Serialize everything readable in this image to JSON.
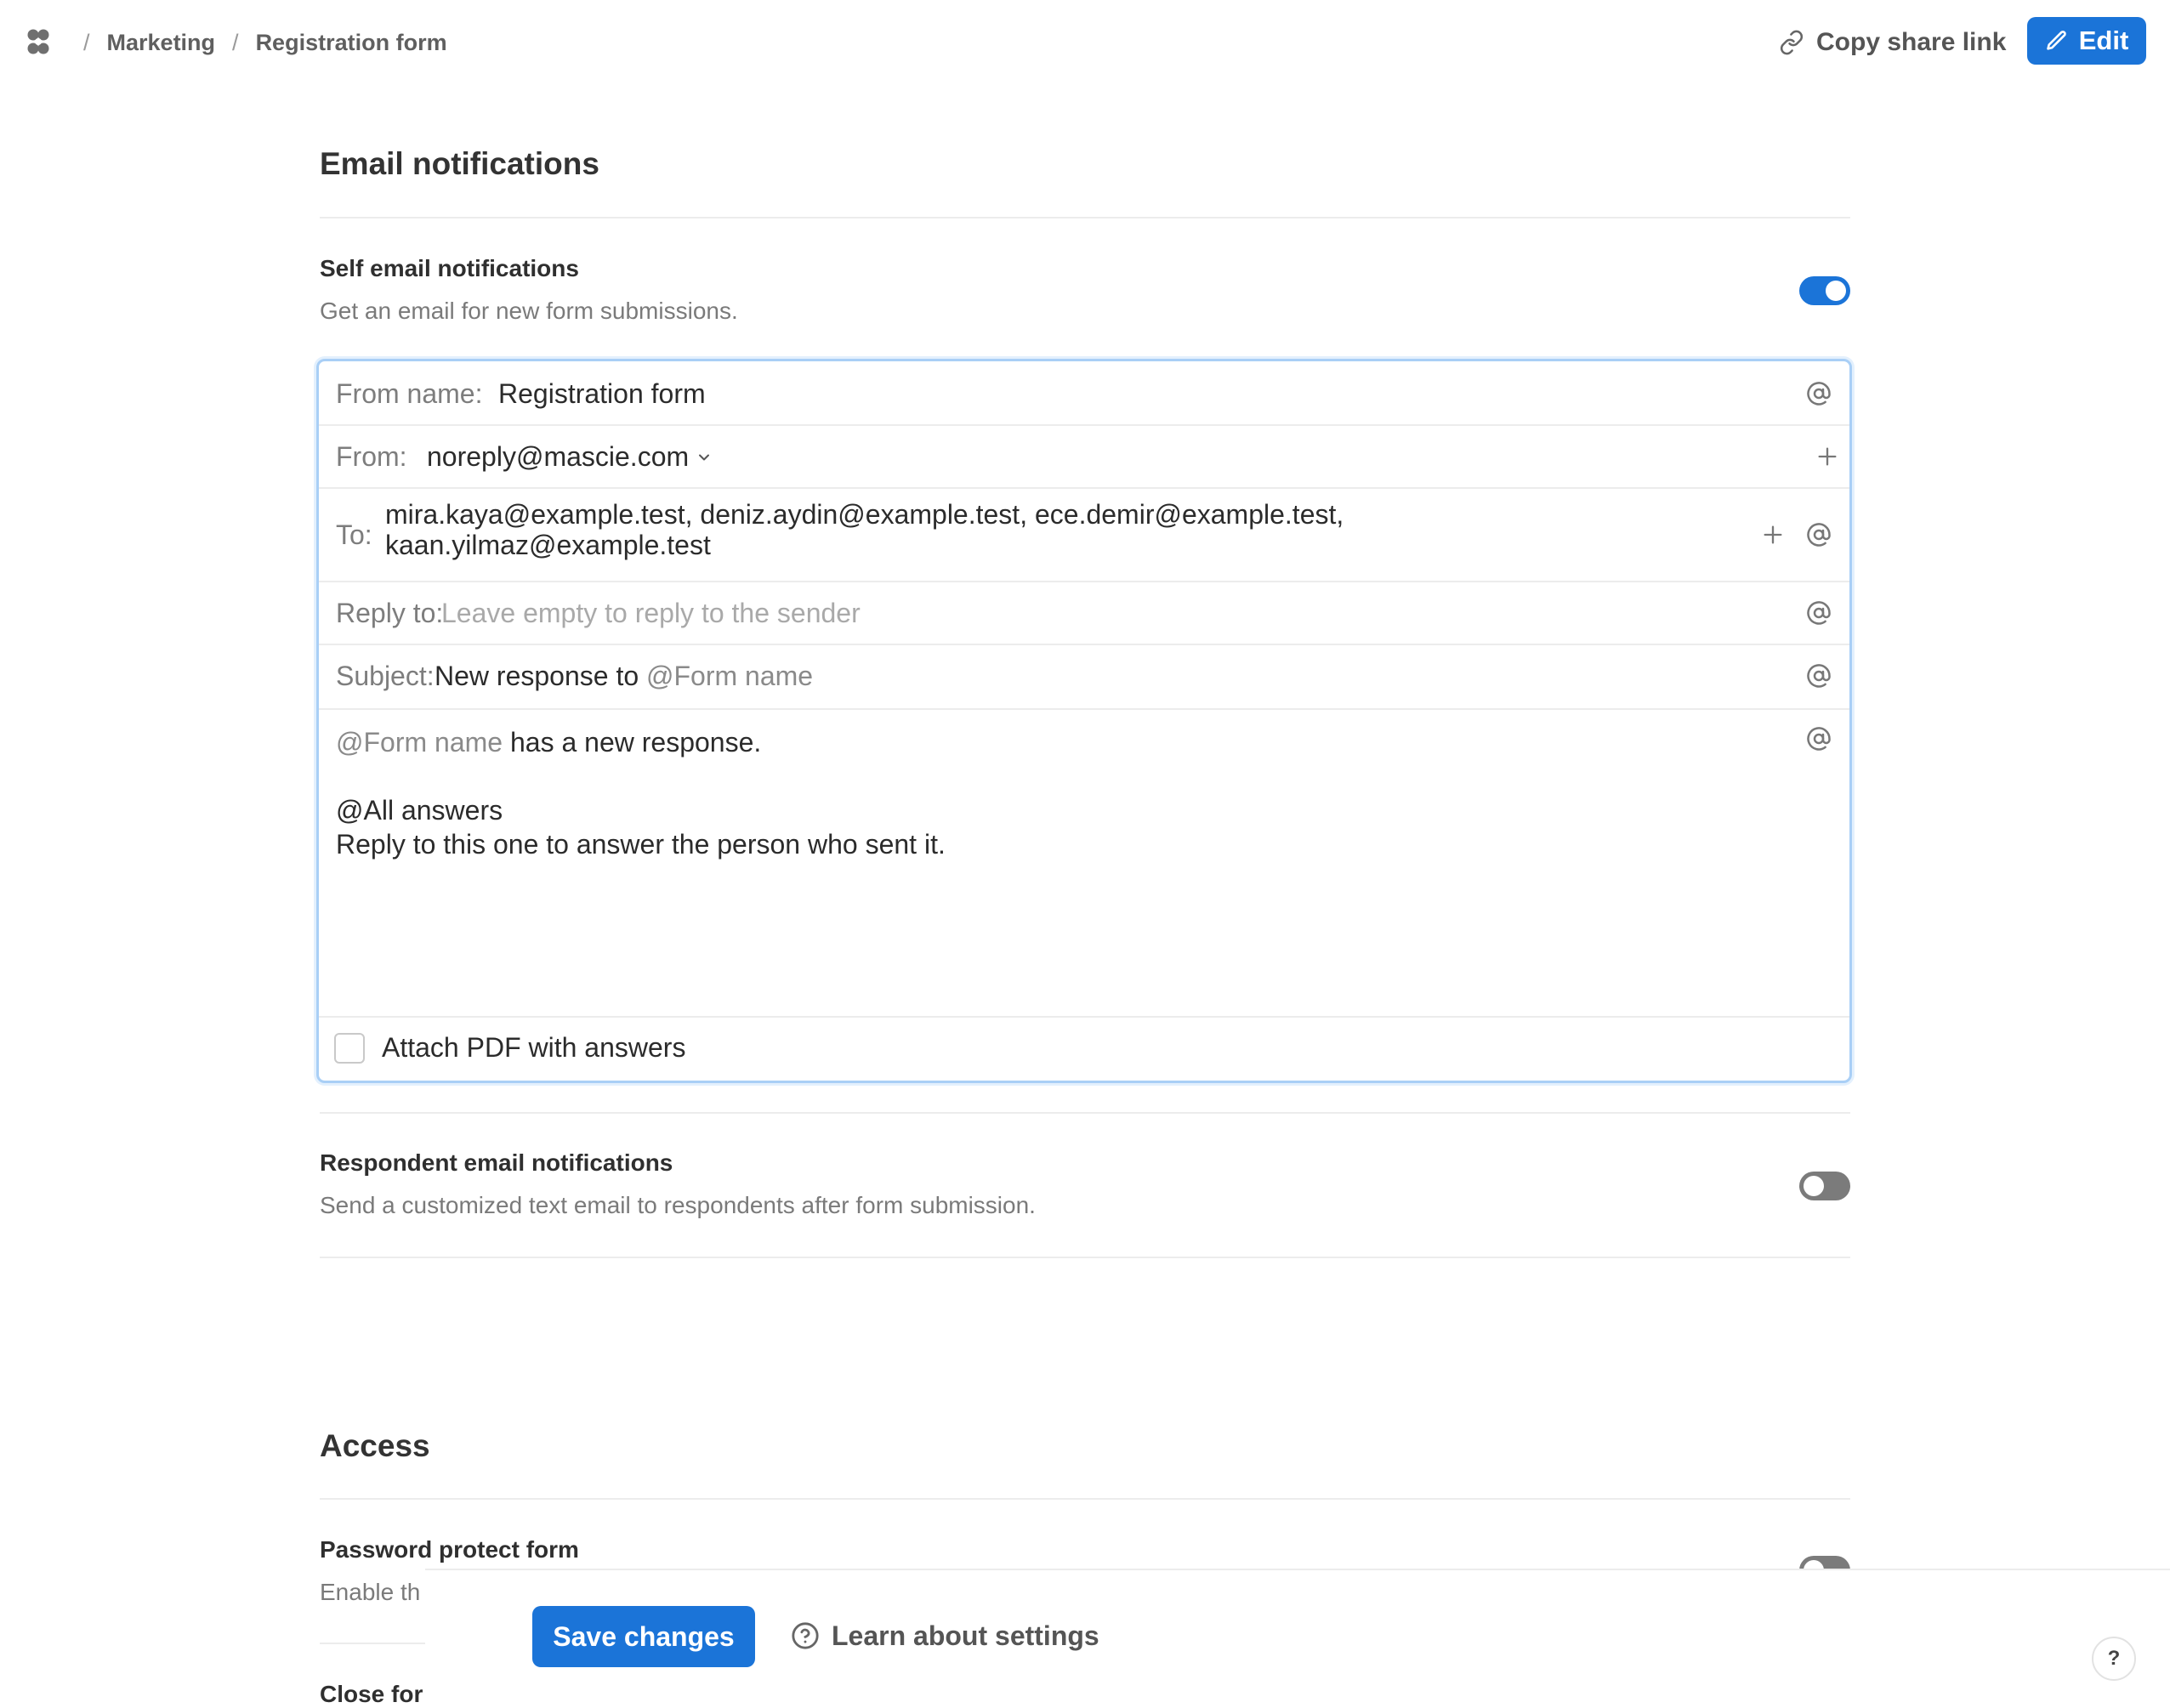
{
  "breadcrumb": {
    "items": [
      "Marketing",
      "Registration form"
    ],
    "separator": "/"
  },
  "header": {
    "share_label": "Copy share link",
    "edit_label": "Edit"
  },
  "email_section": {
    "title": "Email notifications",
    "self": {
      "title": "Self email notifications",
      "description": "Get an email for new form submissions.",
      "enabled": true
    },
    "fields": {
      "from_name_label": "From name:",
      "from_name_value": "Registration form",
      "from_label": "From:",
      "from_value": "noreply@mascie.com",
      "to_label": "To:",
      "to_line1": "mira.kaya@example.test, deniz.aydin@example.test, ece.demir@example.test,",
      "to_line2": "kaan.yilmaz@example.test",
      "reply_label": "Reply to:",
      "reply_placeholder": "Leave empty to reply to the sender",
      "subject_label": "Subject:",
      "subject_text": "New response to",
      "subject_mention": "@Form name"
    },
    "body": {
      "mention_form": "@Form name",
      "line1_text": "has a new response.",
      "mention_answers": "@All answers",
      "line3": "Reply to this one to answer the person who sent it."
    },
    "attach_label": "Attach PDF with answers",
    "respondent": {
      "title": "Respondent email notifications",
      "description": "Send a customized text email to respondents after form submission.",
      "enabled": false
    }
  },
  "access_section": {
    "title": "Access",
    "password": {
      "title": "Password protect form",
      "description_partial": "Enable th",
      "enabled": false
    },
    "close_partial": "Close for"
  },
  "footer": {
    "save_label": "Save changes",
    "learn_label": "Learn about settings",
    "help_label": "?"
  },
  "colors": {
    "accent": "#1b74d8",
    "toggle_off": "#7b7b7b",
    "focus_border": "#a9cff6"
  }
}
